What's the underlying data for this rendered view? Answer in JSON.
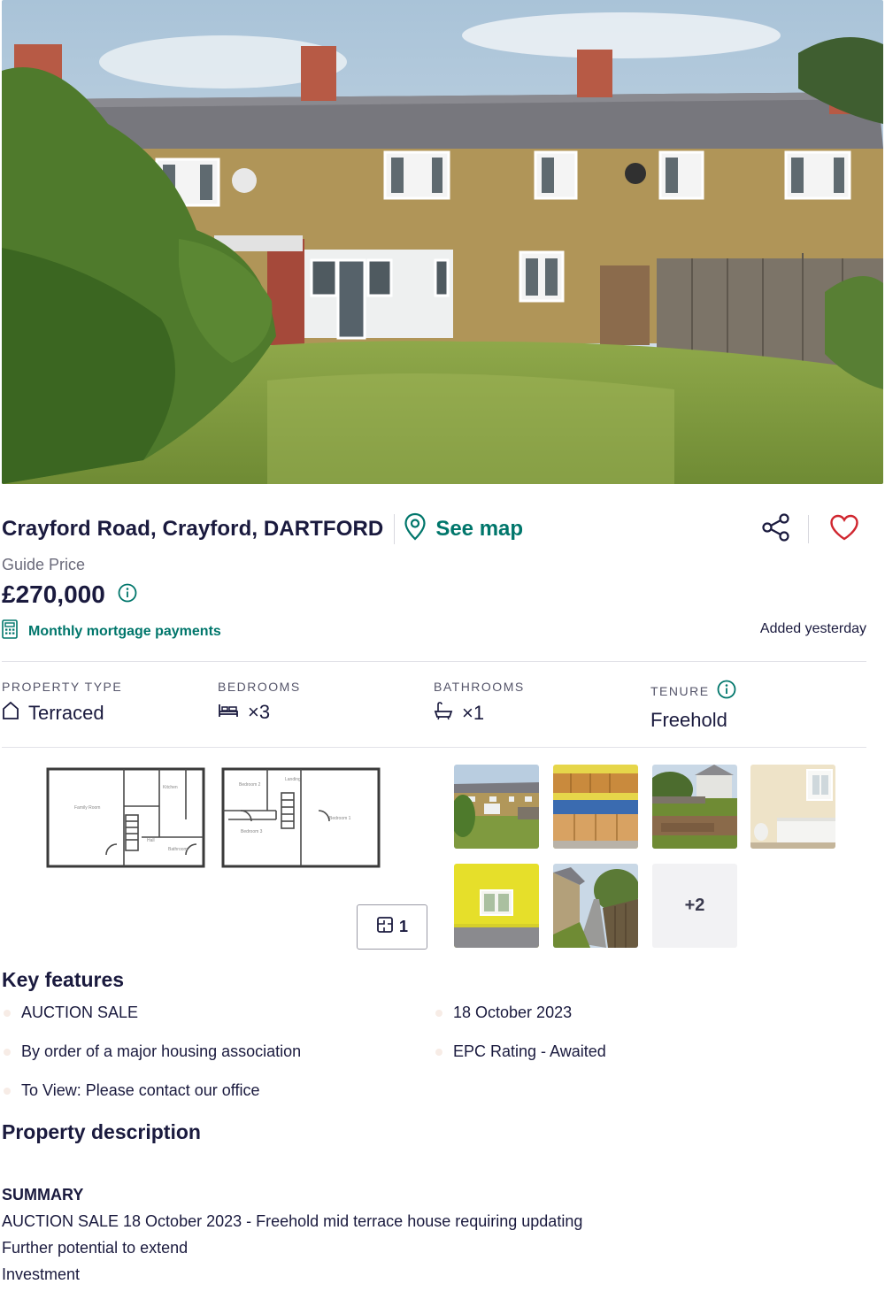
{
  "listing": {
    "address": "Crayford Road, Crayford, DARTFORD",
    "see_map_label": "See map",
    "price_label": "Guide Price",
    "price": "£270,000",
    "mortgage_link": "Monthly mortgage payments",
    "added": "Added yesterday"
  },
  "stats": [
    {
      "label": "PROPERTY TYPE",
      "value": "Terraced",
      "icon": "house-icon"
    },
    {
      "label": "BEDROOMS",
      "value": "×3",
      "icon": "bed-icon"
    },
    {
      "label": "BATHROOMS",
      "value": "×1",
      "icon": "bath-icon"
    },
    {
      "label": "TENURE",
      "value": "Freehold",
      "icon": "info-icon"
    }
  ],
  "media": {
    "floorplan_count": "1",
    "more_photos": "+2",
    "thumbnails": [
      "rear-garden-photo",
      "kitchen-photo",
      "garden-photo",
      "bathroom-photo",
      "yellow-room-photo",
      "side-path-photo"
    ]
  },
  "key_features": {
    "title": "Key features",
    "items": [
      "AUCTION SALE",
      "18 October 2023",
      "By order of a major housing association",
      "EPC Rating - Awaited",
      "To View: Please contact our office"
    ]
  },
  "description": {
    "title": "Property description",
    "heading": "SUMMARY",
    "lines": [
      "AUCTION SALE 18 October 2023 - Freehold mid terrace house requiring updating",
      "Further potential to extend",
      "Investment"
    ]
  },
  "colors": {
    "accent": "#00766b",
    "heart": "#d0262f",
    "text": "#1a1a3e",
    "muted": "#6b6b7b"
  }
}
